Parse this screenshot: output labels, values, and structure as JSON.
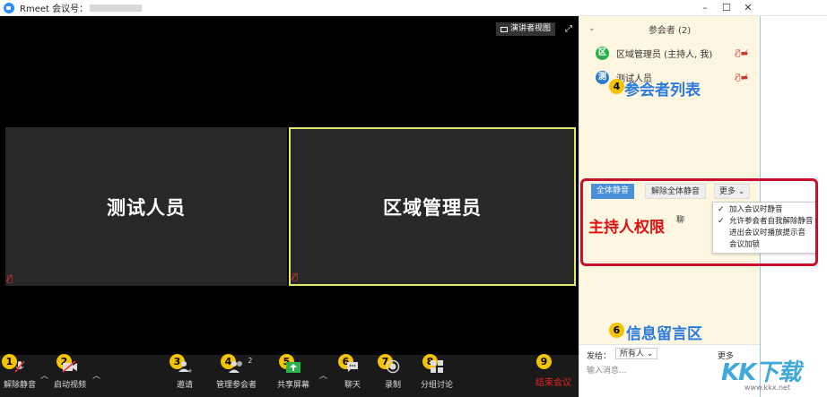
{
  "window": {
    "title": "Rmeet 会议号：",
    "controls": [
      "–",
      "☐",
      "✕"
    ]
  },
  "video": {
    "presenter_view_label": "演讲者视图",
    "tiles": [
      {
        "name": "测试人员"
      },
      {
        "name": "区域管理员"
      }
    ]
  },
  "toolbar": {
    "items": [
      {
        "label": "解除静音",
        "badge": "1"
      },
      {
        "label": "启动视频",
        "badge": "2"
      },
      {
        "label": "邀请",
        "badge": "3"
      },
      {
        "label": "管理参会者",
        "badge": "4",
        "count": "2"
      },
      {
        "label": "共享屏幕",
        "badge": "5"
      },
      {
        "label": "聊天",
        "badge": "6"
      },
      {
        "label": "录制",
        "badge": "7"
      },
      {
        "label": "分组讨论",
        "badge": "8"
      }
    ],
    "end_meeting": {
      "label": "结束会议",
      "badge": "9"
    }
  },
  "participants_panel": {
    "title": "参会者 (2)",
    "participants": [
      {
        "avatar": "区",
        "name": "区域管理员 (主持人, 我)",
        "color": "#2ab24a"
      },
      {
        "avatar": "测",
        "name": "测试人员",
        "color": "#2d7cc9"
      }
    ],
    "annotation": {
      "badge": "4",
      "text": "参会者列表"
    }
  },
  "host_controls": {
    "mute_all": "全体静音",
    "unmute_all": "解除全体静音",
    "more": "更多",
    "partial_text": "聊",
    "annotation": "主持人权限",
    "dropdown": [
      {
        "label": "加入会议时静音",
        "checked": true
      },
      {
        "label": "允许参会者自我解除静音",
        "checked": true
      },
      {
        "label": "进出会议时播放提示音",
        "checked": false
      },
      {
        "label": "会议加锁",
        "checked": false
      }
    ]
  },
  "chat": {
    "annotation": {
      "badge": "6",
      "text": "信息留言区"
    },
    "send_to_label": "发给：",
    "recipient": "所有人",
    "more": "更多",
    "placeholder": "输入消息..."
  },
  "watermark": {
    "text": "KK下载",
    "url": "www.kkx.net"
  },
  "colors": {
    "accent": "#4a90d9",
    "badge": "#f5c400",
    "end": "#e82020",
    "host_box": "#c8102e",
    "active_tile": "#dfe86a"
  }
}
